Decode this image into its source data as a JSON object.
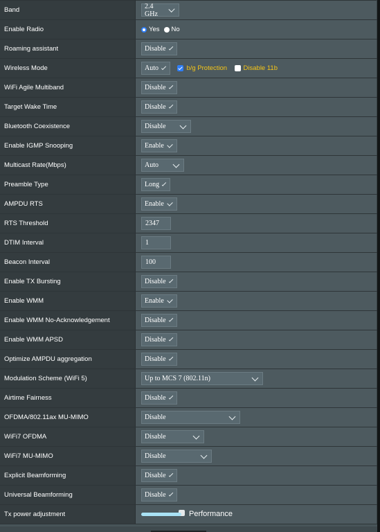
{
  "rows": [
    {
      "label": "Band",
      "type": "select",
      "value": "2.4 GHz"
    },
    {
      "label": "Enable Radio",
      "type": "radio",
      "options": [
        "Yes",
        "No"
      ],
      "selected": "Yes"
    },
    {
      "label": "Roaming assistant",
      "type": "select",
      "value": "Disable"
    },
    {
      "label": "Wireless Mode",
      "type": "select",
      "value": "Auto",
      "checkboxes": [
        {
          "label": "b/g Protection",
          "checked": true
        },
        {
          "label": "Disable 11b",
          "checked": false
        }
      ]
    },
    {
      "label": "WiFi Agile Multiband",
      "type": "select",
      "value": "Disable"
    },
    {
      "label": "Target Wake Time",
      "type": "select",
      "value": "Disable"
    },
    {
      "label": "Bluetooth Coexistence",
      "type": "select",
      "value": "Disable"
    },
    {
      "label": "Enable IGMP Snooping",
      "type": "select",
      "value": "Enable"
    },
    {
      "label": "Multicast Rate(Mbps)",
      "type": "select",
      "value": "Auto"
    },
    {
      "label": "Preamble Type",
      "type": "select",
      "value": "Long"
    },
    {
      "label": "AMPDU RTS",
      "type": "select",
      "value": "Enable"
    },
    {
      "label": "RTS Threshold",
      "type": "input",
      "value": "2347"
    },
    {
      "label": "DTIM Interval",
      "type": "input",
      "value": "1"
    },
    {
      "label": "Beacon Interval",
      "type": "input",
      "value": "100"
    },
    {
      "label": "Enable TX Bursting",
      "type": "select",
      "value": "Disable"
    },
    {
      "label": "Enable WMM",
      "type": "select",
      "value": "Enable"
    },
    {
      "label": "Enable WMM No-Acknowledgement",
      "type": "select",
      "value": "Disable"
    },
    {
      "label": "Enable WMM APSD",
      "type": "select",
      "value": "Disable"
    },
    {
      "label": "Optimize AMPDU aggregation",
      "type": "select",
      "value": "Disable"
    },
    {
      "label": "Modulation Scheme (WiFi 5)",
      "type": "select",
      "value": "Up to MCS 7 (802.11n)"
    },
    {
      "label": "Airtime Fairness",
      "type": "select",
      "value": "Disable"
    },
    {
      "label": "OFDMA/802.11ax MU-MIMO",
      "type": "select",
      "value": "Disable"
    },
    {
      "label": "WiFi7 OFDMA",
      "type": "select",
      "value": "Disable"
    },
    {
      "label": "WiFi7 MU-MIMO",
      "type": "select",
      "value": "Disable"
    },
    {
      "label": "Explicit Beamforming",
      "type": "select",
      "value": "Disable"
    },
    {
      "label": "Universal Beamforming",
      "type": "select",
      "value": "Disable"
    },
    {
      "label": "Tx power adjustment",
      "type": "slider",
      "value_percent": 100,
      "value_label": "Performance"
    }
  ],
  "colors": {
    "accent": "#2f7ef6",
    "warning_text": "#f5c518",
    "slider_fill": "#a9e2f5"
  }
}
